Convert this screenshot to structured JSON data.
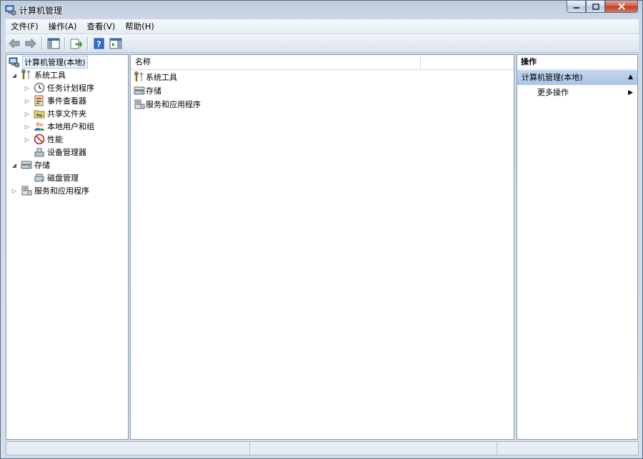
{
  "window": {
    "title": "计算机管理"
  },
  "menubar": {
    "items": [
      "文件(F)",
      "操作(A)",
      "查看(V)",
      "帮助(H)"
    ]
  },
  "tree": {
    "root": "计算机管理(本地)",
    "nodes": [
      {
        "label": "系统工具",
        "expander": "◢",
        "icon": "tools-icon"
      },
      {
        "label": "任务计划程序",
        "expander": "▷",
        "icon": "clock-icon"
      },
      {
        "label": "事件查看器",
        "expander": "▷",
        "icon": "event-viewer-icon"
      },
      {
        "label": "共享文件夹",
        "expander": "▷",
        "icon": "shared-folder-icon"
      },
      {
        "label": "本地用户和组",
        "expander": "▷",
        "icon": "users-icon"
      },
      {
        "label": "性能",
        "expander": "▷",
        "icon": "performance-icon"
      },
      {
        "label": "设备管理器",
        "expander": "",
        "icon": "device-manager-icon"
      },
      {
        "label": "存储",
        "expander": "◢",
        "icon": "storage-icon"
      },
      {
        "label": "磁盘管理",
        "expander": "",
        "icon": "disk-icon"
      },
      {
        "label": "服务和应用程序",
        "expander": "▷",
        "icon": "services-icon"
      }
    ]
  },
  "list": {
    "column_name": "名称",
    "items": [
      {
        "label": "系统工具",
        "icon": "tools-icon"
      },
      {
        "label": "存储",
        "icon": "storage-icon"
      },
      {
        "label": "服务和应用程序",
        "icon": "services-icon"
      }
    ]
  },
  "actions": {
    "header": "操作",
    "section": "计算机管理(本地)",
    "section_arrow": "▲",
    "items": [
      {
        "label": "更多操作",
        "arrow": "▶"
      }
    ]
  }
}
